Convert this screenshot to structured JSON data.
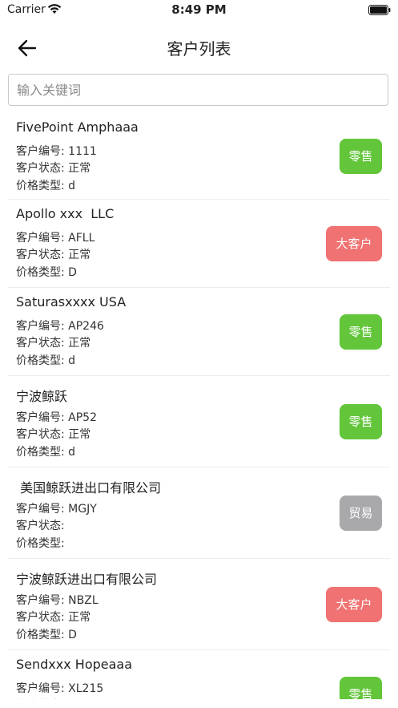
{
  "status_bar": {
    "carrier": "Carrier",
    "time": "8:49 PM"
  },
  "header": {
    "title": "客户列表"
  },
  "search": {
    "placeholder": "输入关键词"
  },
  "labels": {
    "code": "客户编号: ",
    "status": "客户状态: ",
    "price": "价格类型: "
  },
  "customers": [
    {
      "name": "FivePoint Amphaaa",
      "code": "1111",
      "status": "正常",
      "price_type": "d",
      "badge": "零售",
      "badge_color": "#62c53a"
    },
    {
      "name": "Apollo xxx  LLC",
      "code": "AFLL",
      "status": "正常",
      "price_type": "D",
      "badge": "大客户",
      "badge_color": "#f07272"
    },
    {
      "name": "Saturasxxxx USA",
      "code": "AP246",
      "status": "正常",
      "price_type": "d",
      "badge": "零售",
      "badge_color": "#62c53a"
    },
    {
      "name": "宁波鲸跃",
      "code": "AP52",
      "status": "正常",
      "price_type": "d",
      "badge": "零售",
      "badge_color": "#62c53a"
    },
    {
      "name": " 美国鲸跃进出口有限公司",
      "code": "MGJY",
      "status": "",
      "price_type": "",
      "badge": "贸易",
      "badge_color": "#a9a9ac"
    },
    {
      "name": "宁波鲸跃进出口有限公司",
      "code": "NBZL",
      "status": "正常",
      "price_type": "D",
      "badge": "大客户",
      "badge_color": "#f07272"
    },
    {
      "name": "Sendxxx Hopeaaa",
      "code": "XL215",
      "status": "",
      "price_type": "",
      "badge": "零售",
      "badge_color": "#62c53a"
    }
  ]
}
